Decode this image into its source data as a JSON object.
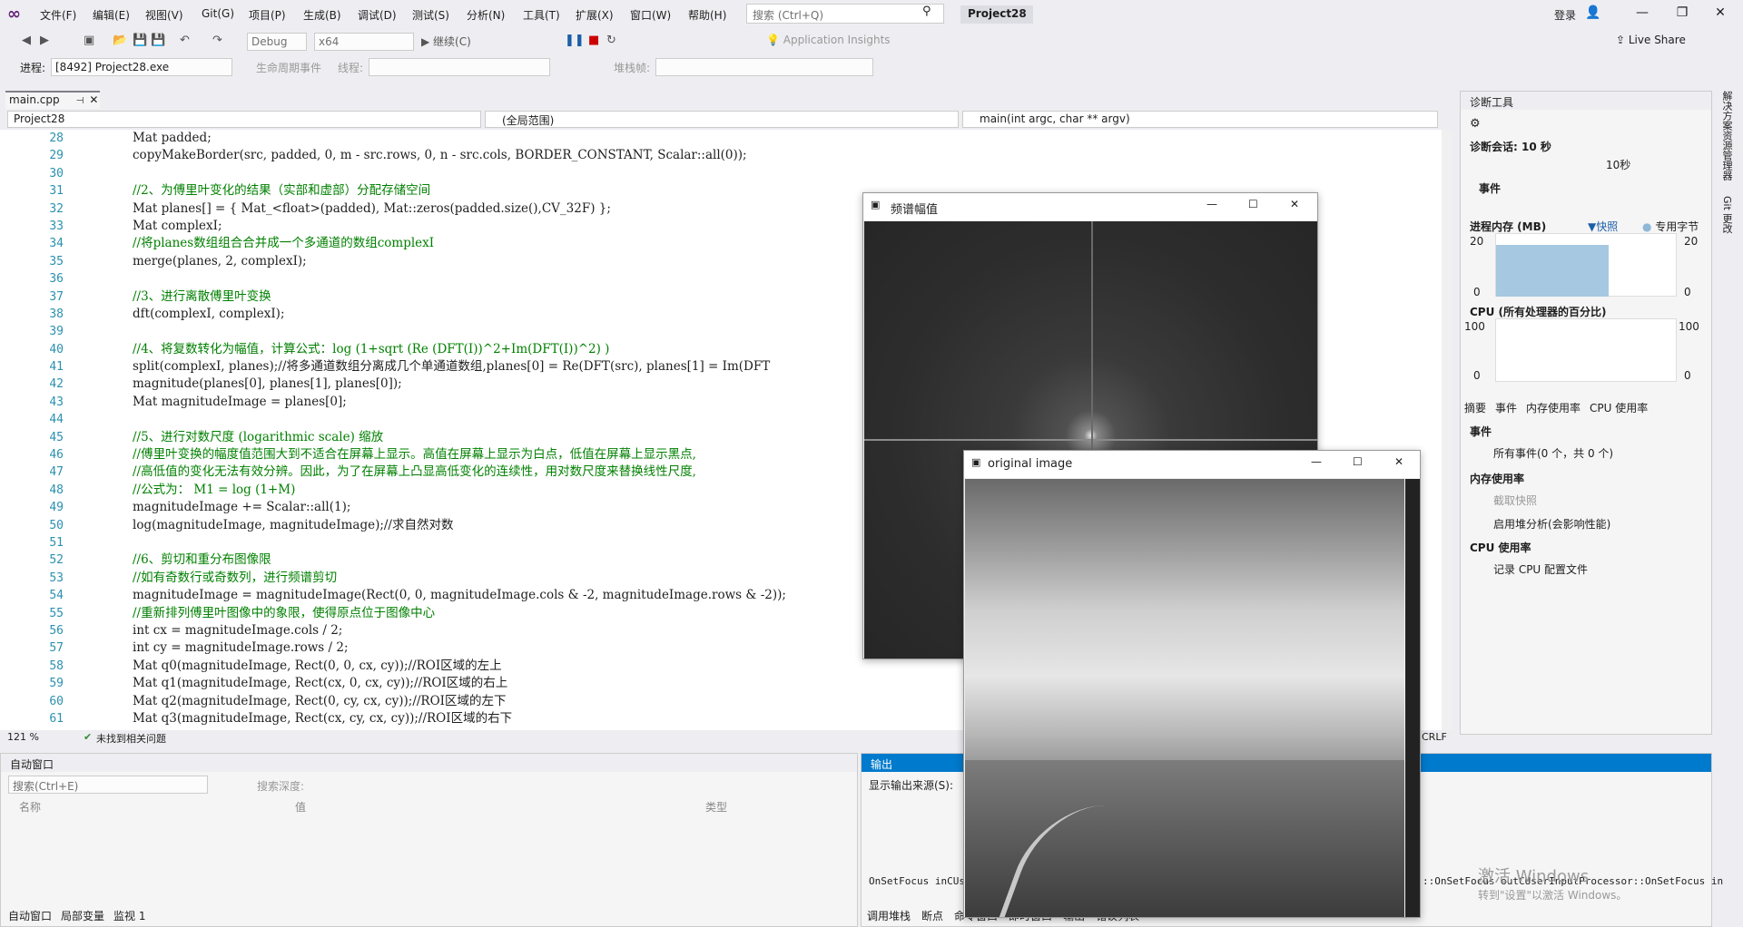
{
  "app": {
    "title": "Project28",
    "search_placeholder": "搜索 (Ctrl+Q)",
    "login": "登录",
    "menus": [
      "文件(F)",
      "编辑(E)",
      "视图(V)",
      "Git(G)",
      "项目(P)",
      "生成(B)",
      "调试(D)",
      "测试(S)",
      "分析(N)",
      "工具(T)",
      "扩展(X)",
      "窗口(W)",
      "帮助(H)"
    ]
  },
  "toolbar": {
    "config": "Debug",
    "platform": "x64",
    "continue": "继续(C)",
    "app_insights": "Application Insights",
    "live_share": "Live Share",
    "process_label": "进程:",
    "process": "[8492] Project28.exe",
    "lifecycle": "生命周期事件",
    "thread": "线程:",
    "stackframe": "堆栈帧:"
  },
  "editor": {
    "tab": "main.cpp",
    "nav_project": "Project28",
    "nav_scope": "(全局范围)",
    "nav_func": "main(int argc, char ** argv)",
    "zoom": "121 %",
    "issues": "未找到相关问题",
    "eol": "CRLF",
    "lines": [
      {
        "n": "28",
        "code": "Mat padded;",
        "cls": ""
      },
      {
        "n": "29",
        "code": "copyMakeBorder(src, padded, 0, m - src.rows, 0, n - src.cols, BORDER_CONSTANT, Scalar::all(0));",
        "cls": ""
      },
      {
        "n": "30",
        "code": "",
        "cls": ""
      },
      {
        "n": "31",
        "code": "//2、为傅里叶变化的结果（实部和虚部）分配存储空间",
        "cls": "c"
      },
      {
        "n": "32",
        "code": "Mat planes[] = { Mat_<float>(padded), Mat::zeros(padded.size(),CV_32F) };",
        "cls": ""
      },
      {
        "n": "33",
        "code": "Mat complexI;",
        "cls": ""
      },
      {
        "n": "34",
        "code": "//将planes数组组合合并成一个多通道的数组complexI",
        "cls": "c"
      },
      {
        "n": "35",
        "code": "merge(planes, 2, complexI);",
        "cls": ""
      },
      {
        "n": "36",
        "code": "",
        "cls": ""
      },
      {
        "n": "37",
        "code": "//3、进行离散傅里叶变换",
        "cls": "c"
      },
      {
        "n": "38",
        "code": "dft(complexI, complexI);",
        "cls": ""
      },
      {
        "n": "39",
        "code": "",
        "cls": ""
      },
      {
        "n": "40",
        "code": "//4、将复数转化为幅值，计算公式：log (1+sqrt (Re (DFT(I))^2+Im(DFT(I))^2) )",
        "cls": "c"
      },
      {
        "n": "41",
        "code": "split(complexI, planes);//将多通道数组分离成几个单通道数组,planes[0] = Re(DFT(src), planes[1] = Im(DFT",
        "cls": ""
      },
      {
        "n": "42",
        "code": "magnitude(planes[0], planes[1], planes[0]);",
        "cls": ""
      },
      {
        "n": "43",
        "code": "Mat magnitudeImage = planes[0];",
        "cls": ""
      },
      {
        "n": "44",
        "code": "",
        "cls": ""
      },
      {
        "n": "45",
        "code": "//5、进行对数尺度 (logarithmic scale) 缩放",
        "cls": "c"
      },
      {
        "n": "46",
        "code": "//傅里叶变换的幅度值范围大到不适合在屏幕上显示。高值在屏幕上显示为白点，低值在屏幕上显示黑点,",
        "cls": "c"
      },
      {
        "n": "47",
        "code": "//高低值的变化无法有效分辨。因此，为了在屏幕上凸显高低变化的连续性，用对数尺度来替换线性尺度,",
        "cls": "c"
      },
      {
        "n": "48",
        "code": "//公式为： M1 = log (1+M)",
        "cls": "c"
      },
      {
        "n": "49",
        "code": "magnitudeImage += Scalar::all(1);",
        "cls": ""
      },
      {
        "n": "50",
        "code": "log(magnitudeImage, magnitudeImage);//求自然对数",
        "cls": ""
      },
      {
        "n": "51",
        "code": "",
        "cls": ""
      },
      {
        "n": "52",
        "code": "//6、剪切和重分布图像限",
        "cls": "c"
      },
      {
        "n": "53",
        "code": "//如有奇数行或奇数列，进行频谱剪切",
        "cls": "c"
      },
      {
        "n": "54",
        "code": "magnitudeImage = magnitudeImage(Rect(0, 0, magnitudeImage.cols & -2, magnitudeImage.rows & -2));",
        "cls": ""
      },
      {
        "n": "55",
        "code": "//重新排列傅里叶图像中的象限，使得原点位于图像中心",
        "cls": "c"
      },
      {
        "n": "56",
        "code": "int cx = magnitudeImage.cols / 2;",
        "cls": ""
      },
      {
        "n": "57",
        "code": "int cy = magnitudeImage.rows / 2;",
        "cls": ""
      },
      {
        "n": "58",
        "code": "Mat q0(magnitudeImage, Rect(0, 0, cx, cy));//ROI区域的左上",
        "cls": ""
      },
      {
        "n": "59",
        "code": "Mat q1(magnitudeImage, Rect(cx, 0, cx, cy));//ROI区域的右上",
        "cls": ""
      },
      {
        "n": "60",
        "code": "Mat q2(magnitudeImage, Rect(0, cy, cx, cy));//ROI区域的左下",
        "cls": ""
      },
      {
        "n": "61",
        "code": "Mat q3(magnitudeImage, Rect(cx, cy, cx, cy));//ROI区域的右下",
        "cls": ""
      }
    ]
  },
  "diag": {
    "title": "诊断工具",
    "session": "诊断会话: 10 秒",
    "timeline": "10秒",
    "events": "事件",
    "memory": "进程内存 (MB)",
    "snapshot": "快照",
    "private": "专用字节",
    "mem_max": "20",
    "mem_min": "0",
    "cpu": "CPU (所有处理器的百分比)",
    "cpu_max": "100",
    "cpu_min": "0",
    "tabs": [
      "摘要",
      "事件",
      "内存使用率",
      "CPU 使用率"
    ],
    "sec_events": "事件",
    "all_events": "所有事件(0 个，共 0 个)",
    "sec_mem": "内存使用率",
    "take_snapshot": "截取快照",
    "heap_analysis": "启用堆分析(会影响性能)",
    "sec_cpu": "CPU 使用率",
    "record_cpu": "记录 CPU 配置文件",
    "side_tabs": [
      "解决方案资源管理器",
      "Git 更改"
    ]
  },
  "auto": {
    "title": "自动窗口",
    "search": "搜索(Ctrl+E)",
    "depth": "搜索深度:",
    "cols": [
      "名称",
      "值",
      "类型"
    ],
    "tabs": [
      "自动窗口",
      "局部变量",
      "监视 1"
    ]
  },
  "output": {
    "title": "输出",
    "source_label": "显示输出来源(S):",
    "log_left": "OnSetFocus inCUse",
    "log_right": "::OnSetFocus outCUserInputProcessor::OnSetFocus in",
    "tabs": [
      "调用堆栈",
      "断点",
      "命令窗口",
      "即时窗口",
      "输出",
      "错误列表"
    ]
  },
  "spectrum_window": {
    "title": "频谱幅值"
  },
  "original_window": {
    "title": "original image"
  },
  "watermark": {
    "line1": "激活 Windows",
    "line2": "转到\"设置\"以激活 Windows。"
  },
  "colors": {
    "accent": "#007acc",
    "comment": "#008000",
    "keyword": "#0000ff",
    "type": "#2b91af",
    "vs_purple": "#68217a"
  }
}
